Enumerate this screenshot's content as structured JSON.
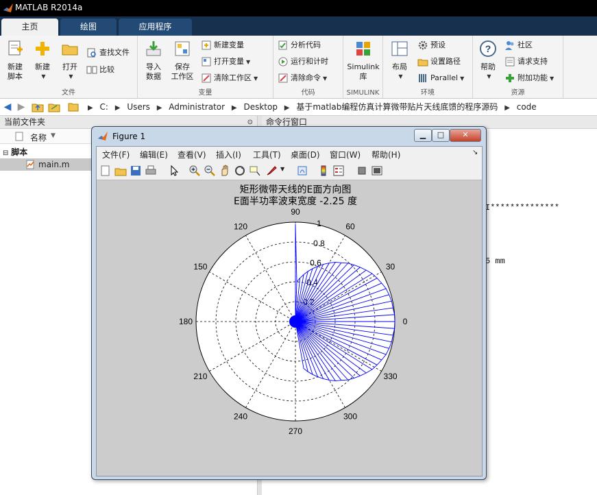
{
  "app": {
    "title": "MATLAB R2014a"
  },
  "tabs": [
    {
      "label": "主页",
      "active": true
    },
    {
      "label": "绘图",
      "active": false
    },
    {
      "label": "应用程序",
      "active": false
    }
  ],
  "ribbon": {
    "file_group": {
      "label": "文件",
      "new_script": "新建\n脚本",
      "new": "新建",
      "open": "打开",
      "find_files": "查找文件",
      "compare": "比较"
    },
    "variable_group": {
      "label": "变量",
      "import": "导入\n数据",
      "save_ws": "保存\n工作区",
      "new_var": "新建变量",
      "open_var": "打开变量",
      "clear_ws": "清除工作区"
    },
    "code_group": {
      "label": "代码",
      "analyze": "分析代码",
      "run_time": "运行和计时",
      "clear_cmd": "清除命令"
    },
    "simulink_group": {
      "label": "SIMULINK",
      "simulink": "Simulink\n库"
    },
    "env_group": {
      "label": "环境",
      "layout": "布局",
      "prefs": "预设",
      "set_path": "设置路径",
      "parallel": "Parallel"
    },
    "resource_group": {
      "label": "资源",
      "help": "帮助",
      "community": "社区",
      "support": "请求支持",
      "addons": "附加功能"
    }
  },
  "address": {
    "crumbs": [
      "C:",
      "Users",
      "Administrator",
      "Desktop",
      "基于matlab编程仿真计算微带贴片天线底馈的程序源码",
      "code"
    ]
  },
  "left_panel": {
    "title": "当前文件夹",
    "column_header": "名称",
    "folder": "脚本",
    "file": "main.m"
  },
  "command_window": {
    "title": "命令行窗口",
    "line1": "I**************",
    "line2": "5 mm"
  },
  "figure": {
    "title": "Figure 1",
    "menus": [
      "文件(F)",
      "编辑(E)",
      "查看(V)",
      "插入(I)",
      "工具(T)",
      "桌面(D)",
      "窗口(W)",
      "帮助(H)"
    ],
    "plot_title_1": "矩形微带天线的E面方向图",
    "plot_title_2": "E面半功率波束宽度 -2.25 度",
    "angle_labels": [
      "0",
      "30",
      "60",
      "90",
      "120",
      "150",
      "180",
      "210",
      "240",
      "270",
      "300",
      "330"
    ],
    "radial_labels": [
      "0.2",
      "0.4",
      "0.6",
      "0.8",
      "1"
    ]
  },
  "chart_data": {
    "type": "line",
    "polar": true,
    "title": "矩形微带天线的E面方向图",
    "subtitle": "E面半功率波束宽度 -2.25 度",
    "rlim": [
      0,
      1
    ],
    "angle_ticks_deg": [
      0,
      30,
      60,
      90,
      120,
      150,
      180,
      210,
      240,
      270,
      300,
      330
    ],
    "radial_ticks": [
      0.2,
      0.4,
      0.6,
      0.8,
      1
    ],
    "grid": true,
    "series_color": "#0000ff",
    "series": [
      {
        "points": [
          [
            0,
            1.0
          ],
          [
            4,
            1.0
          ],
          [
            8,
            0.99
          ],
          [
            12,
            0.99
          ],
          [
            16,
            0.98
          ],
          [
            20,
            0.97
          ],
          [
            24,
            0.95
          ],
          [
            28,
            0.93
          ],
          [
            32,
            0.91
          ],
          [
            36,
            0.88
          ],
          [
            40,
            0.85
          ],
          [
            44,
            0.82
          ],
          [
            48,
            0.79
          ],
          [
            52,
            0.75
          ],
          [
            56,
            0.72
          ],
          [
            60,
            0.68
          ],
          [
            64,
            0.64
          ],
          [
            68,
            0.6
          ],
          [
            72,
            0.56
          ],
          [
            76,
            0.52
          ],
          [
            80,
            0.48
          ],
          [
            84,
            0.44
          ],
          [
            88,
            0.4
          ],
          [
            90,
            0.98
          ],
          [
            -4,
            1.0
          ],
          [
            -8,
            0.99
          ],
          [
            -12,
            0.99
          ],
          [
            -16,
            0.98
          ],
          [
            -20,
            0.97
          ],
          [
            -24,
            0.95
          ],
          [
            -28,
            0.93
          ],
          [
            -32,
            0.91
          ],
          [
            -36,
            0.88
          ],
          [
            -40,
            0.85
          ],
          [
            -44,
            0.82
          ],
          [
            -48,
            0.79
          ],
          [
            -52,
            0.75
          ],
          [
            -56,
            0.72
          ],
          [
            -60,
            0.68
          ],
          [
            -64,
            0.64
          ],
          [
            -68,
            0.6
          ],
          [
            -72,
            0.56
          ],
          [
            -76,
            0.52
          ],
          [
            -80,
            0.48
          ]
        ]
      }
    ]
  }
}
